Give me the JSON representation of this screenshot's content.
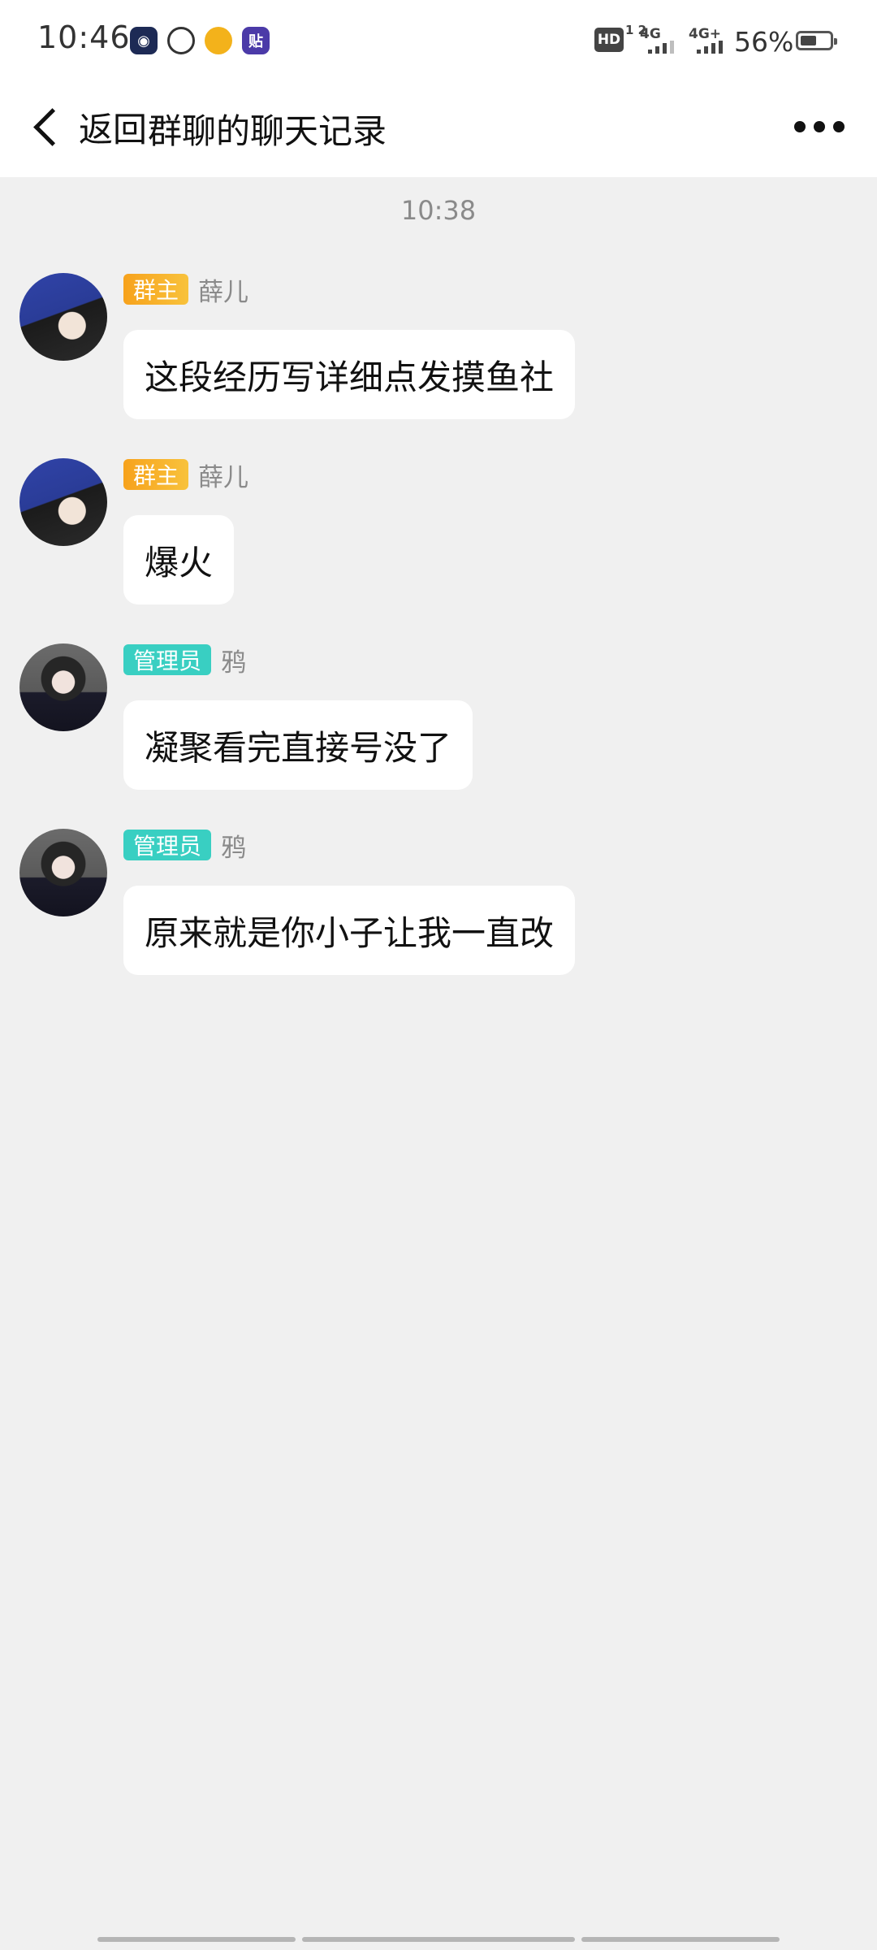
{
  "status_bar": {
    "time": "10:46",
    "notification_icons": [
      "app-notif-1",
      "cat-notif",
      "dog-notif",
      "tieba-notif"
    ],
    "notif_4_glyph": "贴",
    "hd_label": "HD",
    "hd_sub": "1 2",
    "network_1": "4G",
    "network_2": "4G+",
    "battery_percent": "56%",
    "battery_level": 0.56
  },
  "header": {
    "back_label": "返回",
    "title": "群聊的聊天记录"
  },
  "chat": {
    "time_divider": "10:38",
    "messages": [
      {
        "badge": "群主",
        "sender": "薛儿",
        "text": "这段经历写详细点发摸鱼社",
        "role": "owner"
      },
      {
        "badge": "群主",
        "sender": "薛儿",
        "text": "爆火",
        "role": "owner"
      },
      {
        "badge": "管理员",
        "sender": "鸦",
        "text": "凝聚看完直接号没了",
        "role": "admin"
      },
      {
        "badge": "管理员",
        "sender": "鸦",
        "text": "原来就是你小子让我一直改",
        "role": "admin"
      }
    ]
  },
  "colors": {
    "owner_badge": "#f7a21c",
    "admin_badge": "#39cfc2",
    "background": "#f0f0f0",
    "bubble": "#ffffff"
  }
}
